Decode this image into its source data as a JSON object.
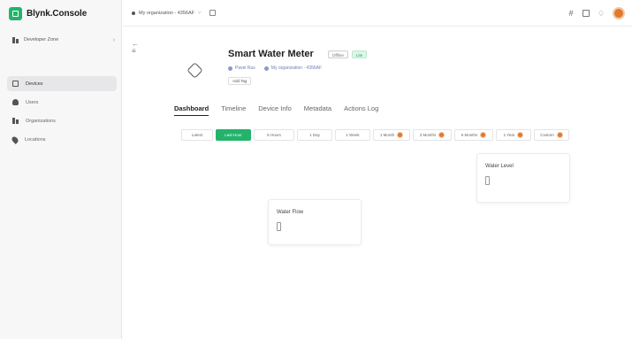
{
  "app": {
    "name": "Blynk.Console"
  },
  "sidebar": {
    "org_selector": "Developer Zone",
    "items": [
      {
        "label": "Devices",
        "icon": "devices-icon",
        "active": true
      },
      {
        "label": "Users",
        "icon": "users-icon",
        "active": false
      },
      {
        "label": "Organizations",
        "icon": "organizations-icon",
        "active": false
      },
      {
        "label": "Locations",
        "icon": "locations-icon",
        "active": false
      }
    ]
  },
  "topbar": {
    "org_label": "My organization - 4356AF",
    "icons": [
      "code-icon",
      "help-icon",
      "bell-icon",
      "user-avatar"
    ]
  },
  "device": {
    "name": "Smart Water Meter",
    "status": "Offline",
    "badge": "Lite",
    "owner": "Pavel Rus",
    "organization": "My organization - 4356AF",
    "add_tag": "Add Tag"
  },
  "tabs": [
    "Dashboard",
    "Timeline",
    "Device Info",
    "Metadata",
    "Actions Log"
  ],
  "active_tab": "Dashboard",
  "time_ranges": [
    "Latest",
    "Last Hour",
    "6 Hours",
    "1 Day",
    "1 Week",
    "1 Month",
    "3 Months",
    "6 Months",
    "1 Year",
    "Custom"
  ],
  "active_range": "Last Hour",
  "widgets": [
    {
      "title": "Water Level",
      "value": ""
    },
    {
      "title": "Water Flow",
      "value": ""
    }
  ],
  "colors": {
    "accent": "#23b36b",
    "avatar": "#e07a2c"
  }
}
